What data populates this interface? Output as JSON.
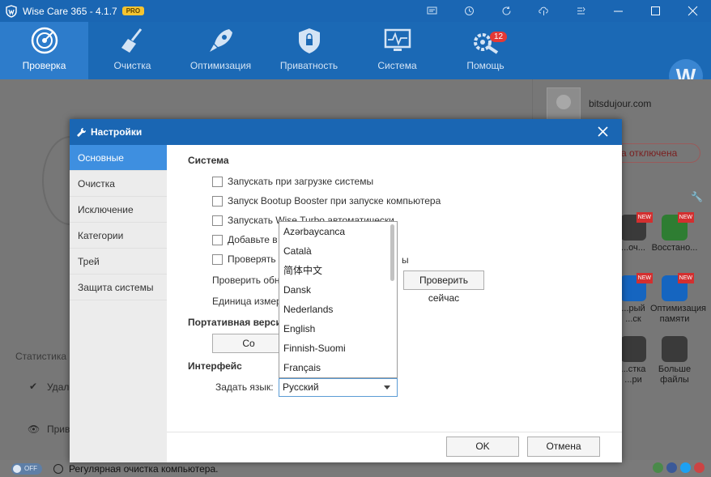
{
  "app": {
    "title": "Wise Care 365 - 4.1.7",
    "badge": "PRO",
    "accent": "#1a66b3"
  },
  "nav": {
    "tabs": [
      {
        "label": "Проверка",
        "icon": "radar-icon"
      },
      {
        "label": "Очистка",
        "icon": "broom-icon"
      },
      {
        "label": "Оптимизация",
        "icon": "rocket-icon"
      },
      {
        "label": "Приватность",
        "icon": "shield-icon"
      },
      {
        "label": "Система",
        "icon": "monitor-icon"
      },
      {
        "label": "Помощь",
        "icon": "gears-icon",
        "badge": "12"
      }
    ],
    "avatar_letter": "W"
  },
  "profile": {
    "email": "bitsdujour.com",
    "status": "а отключена"
  },
  "tools": [
    {
      "label": "...оч...",
      "new": "NEW"
    },
    {
      "label": "Восстано...",
      "new": "NEW"
    },
    {
      "label": "...рый\n...ск",
      "new": "NEW"
    },
    {
      "label": "Оптимизация\nпамяти",
      "new": "NEW"
    },
    {
      "label": "...стка\n...ри"
    },
    {
      "label": "Больше\nфайлы"
    }
  ],
  "left_panel": {
    "stats_label": "Статистика",
    "row1": "Удале",
    "row2": "Прива"
  },
  "statusbar": {
    "toggle": "OFF",
    "text": "Регулярная очистка компьютера."
  },
  "dialog": {
    "title": "Настройки",
    "sidebar": [
      "Основные",
      "Очистка",
      "Исключение",
      "Категории",
      "Трей",
      "Защита системы"
    ],
    "section_system": "Система",
    "checkboxes": [
      "Запускать при загрузке системы",
      "Запуск Bootup Booster при запуске компьютера",
      "Запускать Wise Turbo автоматически",
      "Добавьте в к",
      "Проверять н"
    ],
    "checkbox5_tail": "ы",
    "check_updates_label": "Проверить обно",
    "check_now_button": "Проверить сейчас",
    "unit_label": "Единица измере",
    "section_portable": "Портативная верси",
    "portable_button": "Со",
    "section_interface": "Интерфейс",
    "language_label": "Задать язык:",
    "language_selected": "Русский",
    "language_options": [
      "Azərbaycanca",
      "Català",
      "简体中文",
      "Dansk",
      "Nederlands",
      "English",
      "Finnish-Suomi",
      "Français"
    ],
    "ok_button": "OK",
    "cancel_button": "Отмена"
  }
}
